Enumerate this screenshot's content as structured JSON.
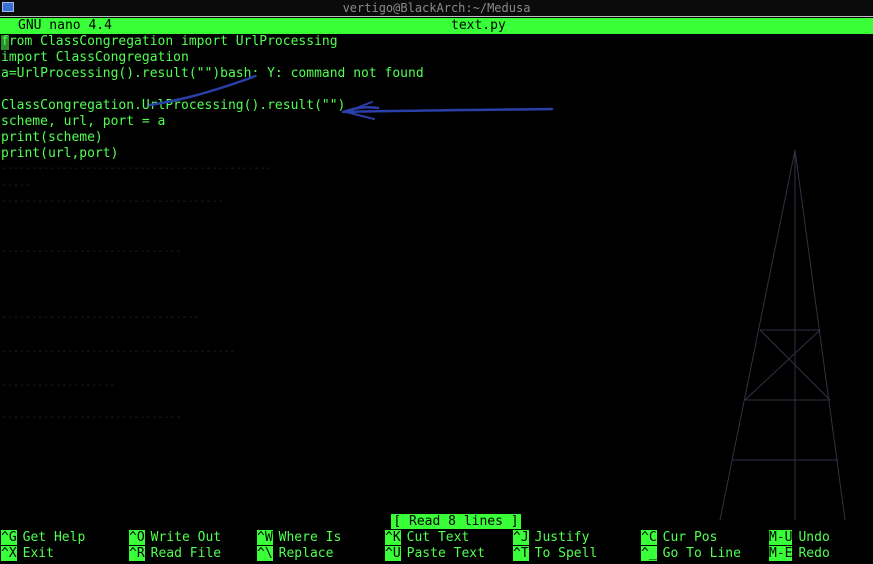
{
  "window": {
    "title": "vertigo@BlackArch:~/Medusa"
  },
  "nano": {
    "version": "GNU nano 4.4",
    "filename": "text.py"
  },
  "editor": {
    "lines": [
      "from ClassCongregation import UrlProcessing",
      "import ClassCongregation",
      "a=UrlProcessing().result(\"\")bash: Y: command not found",
      "",
      "ClassCongregation.UrlProcessing().result(\"\")",
      "scheme, url, port = a",
      "print(scheme)",
      "print(url,port)"
    ]
  },
  "status": {
    "message": "[ Read 8 lines ]"
  },
  "shortcuts": [
    {
      "key": "^G",
      "label": "Get Help"
    },
    {
      "key": "^O",
      "label": "Write Out"
    },
    {
      "key": "^W",
      "label": "Where Is"
    },
    {
      "key": "^K",
      "label": "Cut Text"
    },
    {
      "key": "^J",
      "label": "Justify"
    },
    {
      "key": "^C",
      "label": "Cur Pos"
    },
    {
      "key": "M-U",
      "label": "Undo"
    },
    {
      "key": "^X",
      "label": "Exit"
    },
    {
      "key": "^R",
      "label": "Read File"
    },
    {
      "key": "^\\",
      "label": "Replace"
    },
    {
      "key": "^U",
      "label": "Paste Text"
    },
    {
      "key": "^T",
      "label": "To Spell"
    },
    {
      "key": "^_",
      "label": "Go To Line"
    },
    {
      "key": "M-E",
      "label": "Redo"
    }
  ],
  "colors": {
    "accent": "#39ff39",
    "text": "#50ff50",
    "background": "#000000",
    "annotation": "#2a3fa8"
  }
}
